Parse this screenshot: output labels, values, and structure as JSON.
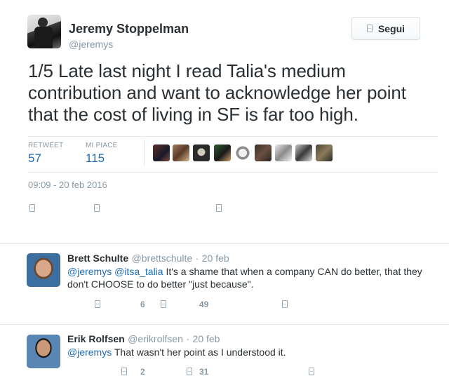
{
  "main_tweet": {
    "author_name": "Jeremy Stoppelman",
    "author_handle": "@jeremys",
    "follow_label": "Segui",
    "text": "1/5 Late last night I read Talia's medium contribution and want to acknowledge her point that the cost of living in SF is far too high.",
    "stats": {
      "retweet_label": "RETWEET",
      "retweet_count": "57",
      "likes_label": "MI PIACE",
      "likes_count": "115"
    },
    "timestamp": "09:09 - 20 feb 2016",
    "liker_avatar_icons": [
      "avatar-1",
      "avatar-2",
      "avatar-3",
      "avatar-4",
      "avatar-5",
      "avatar-6",
      "avatar-7",
      "avatar-8",
      "avatar-9"
    ],
    "actions": [
      "reply-icon",
      "retweet-icon",
      "like-icon"
    ]
  },
  "replies": [
    {
      "author_name": "Brett Schulte",
      "author_handle": "@brettschulte",
      "dot": "·",
      "date": "20 feb",
      "mentions": [
        "@jeremys",
        "@itsa_talia"
      ],
      "text": "It's a shame that when a company CAN do better, that they don't CHOOSE to do better \"just because\".",
      "retweet_count": "6",
      "like_count": "49"
    },
    {
      "author_name": "Erik Rolfsen",
      "author_handle": "@erikrolfsen",
      "dot": "·",
      "date": "20 feb",
      "mentions": [
        "@jeremys"
      ],
      "text": "That wasn't her point as I understood it.",
      "retweet_count": "2",
      "like_count": "31"
    }
  ],
  "colors": {
    "link": "#1b6db8",
    "muted": "#8899a6",
    "text": "#292f33",
    "divider": "#e1e8ed"
  }
}
